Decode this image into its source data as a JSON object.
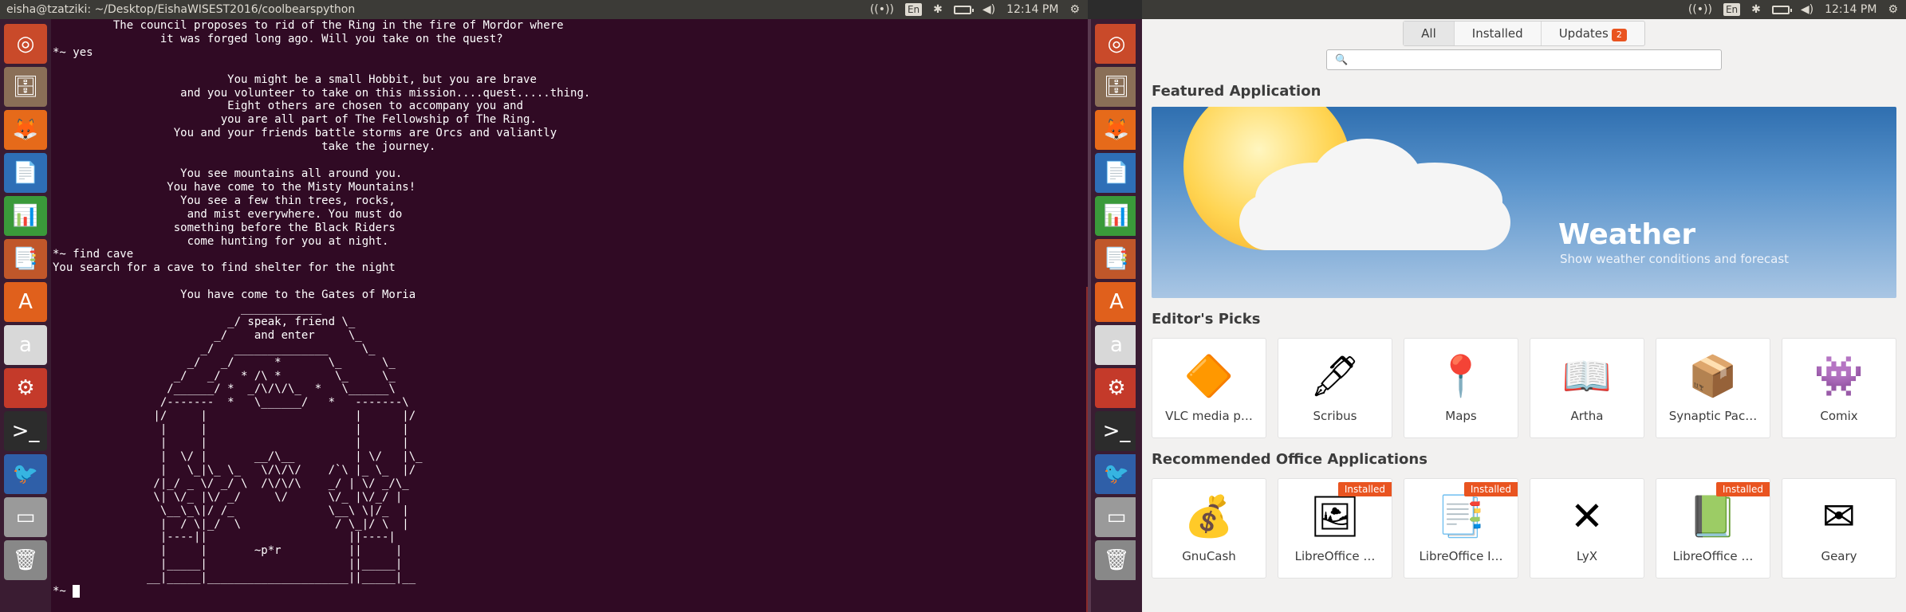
{
  "left_topbar": {
    "title": "eisha@tzatziki: ~/Desktop/EishaWISEST2016/coolbearspython",
    "lang": "En",
    "time": "12:14 PM"
  },
  "right_topbar": {
    "lang": "En",
    "time": "12:14 PM"
  },
  "launcher_items": [
    {
      "name": "ubuntu-dash-icon",
      "glyph": "◎",
      "bg": "#c94a2a"
    },
    {
      "name": "files-icon",
      "glyph": "🗄",
      "bg": "#8a6f57"
    },
    {
      "name": "firefox-icon",
      "glyph": "🦊",
      "bg": "#e66a1a"
    },
    {
      "name": "writer-icon",
      "glyph": "📄",
      "bg": "#2e6fb7"
    },
    {
      "name": "calc-icon",
      "glyph": "📊",
      "bg": "#3a9a3a"
    },
    {
      "name": "impress-icon",
      "glyph": "📑",
      "bg": "#c0572a"
    },
    {
      "name": "software-center-icon",
      "glyph": "A",
      "bg": "#e0601c"
    },
    {
      "name": "amazon-icon",
      "glyph": "a",
      "bg": "#d8d8d8"
    },
    {
      "name": "system-settings-icon",
      "glyph": "⚙",
      "bg": "#c43a2a"
    },
    {
      "name": "terminal-icon",
      "glyph": ">_",
      "bg": "#2c2c2c"
    },
    {
      "name": "thunderbird-icon",
      "glyph": "🐦",
      "bg": "#2f5fa8"
    },
    {
      "name": "drive-icon",
      "glyph": "▭",
      "bg": "#9a9a9a"
    },
    {
      "name": "trash-icon",
      "glyph": "🗑",
      "bg": "#888888"
    }
  ],
  "terminal": {
    "output": "         The council proposes to rid of the Ring in the fire of Mordor where\n                it was forged long ago. Will you take on the quest?\n*~ yes\n\n                          You might be a small Hobbit, but you are brave\n                   and you volunteer to take on this mission....quest.....thing.\n                          Eight others are chosen to accompany you and\n                         you are all part of The Fellowship of The Ring.\n                  You and your friends battle storms are Orcs and valiantly\n                                        take the journey.\n\n                   You see mountains all around you.\n                 You have come to the Misty Mountains!\n                   You see a few thin trees, rocks,\n                    and mist everywhere. You must do\n                  something before the Black Riders\n                    come hunting for you at night.\n*~ find cave\nYou search for a cave to find shelter for the night\n\n                   You have come to the Gates of Moria\n                            ____________\n                          _/ speak, friend \\_\n                        _/    and enter     \\_\n                      _/   ______________     \\_\n                    _/   _/      *       \\_      \\_\n                  _/   _/   * /\\ *        \\_     \\_\n                 /______/ *  _/\\/\\/\\_  *   \\______\\\n                /-------  *   \\______/   *   -------\\\n               |/     |                      |      |/\n                |     |                      |      |\n                |     |                      |      |\n                |  \\/ |       __/\\__         | \\/   |\\_\n                |   \\_|\\_ \\_   \\/\\/\\/    /`\\ |_ \\_  |/\n               /|_/ _ \\/ _/ \\  /\\/\\/\\    _/ | \\/ _/\\_\n               \\| \\/_ |\\/ _/     \\/      \\/_ |\\/_/ |\n                \\__\\_\\|/ /_              \\__\\ \\|/_  |\n                |  / \\|_/  \\              / \\_|/ \\  |\n                |----||                     ||----|\n                |     |       ~p*r          ||     |\n                |_____|                     ||_____|\n              __|_____|_____________________||_____|__\n*~ ",
    "prompt_suffix": ""
  },
  "software_center": {
    "tabs": [
      {
        "label": "All",
        "active": true
      },
      {
        "label": "Installed",
        "active": false
      },
      {
        "label": "Updates",
        "active": false,
        "badge": "2"
      }
    ],
    "search_placeholder": "",
    "featured_title": "Featured Application",
    "featured": {
      "title": "Weather",
      "subtitle": "Show weather conditions and forecast"
    },
    "editors_title": "Editor's Picks",
    "editors": [
      {
        "name": "VLC media p…",
        "icon": "vlc-icon",
        "glyph": "🔶"
      },
      {
        "name": "Scribus",
        "icon": "scribus-icon",
        "glyph": "🖋"
      },
      {
        "name": "Maps",
        "icon": "maps-icon",
        "glyph": "📍"
      },
      {
        "name": "Artha",
        "icon": "artha-icon",
        "glyph": "📖"
      },
      {
        "name": "Synaptic Pac…",
        "icon": "synaptic-icon",
        "glyph": "📦"
      },
      {
        "name": "Comix",
        "icon": "comix-icon",
        "glyph": "👾"
      }
    ],
    "office_title": "Recommended Office Applications",
    "office": [
      {
        "name": "GnuCash",
        "icon": "gnucash-icon",
        "glyph": "💰",
        "installed": false
      },
      {
        "name": "LibreOffice …",
        "icon": "libreoffice-draw-icon",
        "glyph": "🖼",
        "installed": true
      },
      {
        "name": "LibreOffice I…",
        "icon": "libreoffice-impress-icon",
        "glyph": "📑",
        "installed": true
      },
      {
        "name": "LyX",
        "icon": "lyx-icon",
        "glyph": "✕",
        "installed": false
      },
      {
        "name": "LibreOffice …",
        "icon": "libreoffice-calc-icon",
        "glyph": "📗",
        "installed": true
      },
      {
        "name": "Geary",
        "icon": "geary-icon",
        "glyph": "✉",
        "installed": false
      }
    ],
    "installed_label": "Installed"
  }
}
